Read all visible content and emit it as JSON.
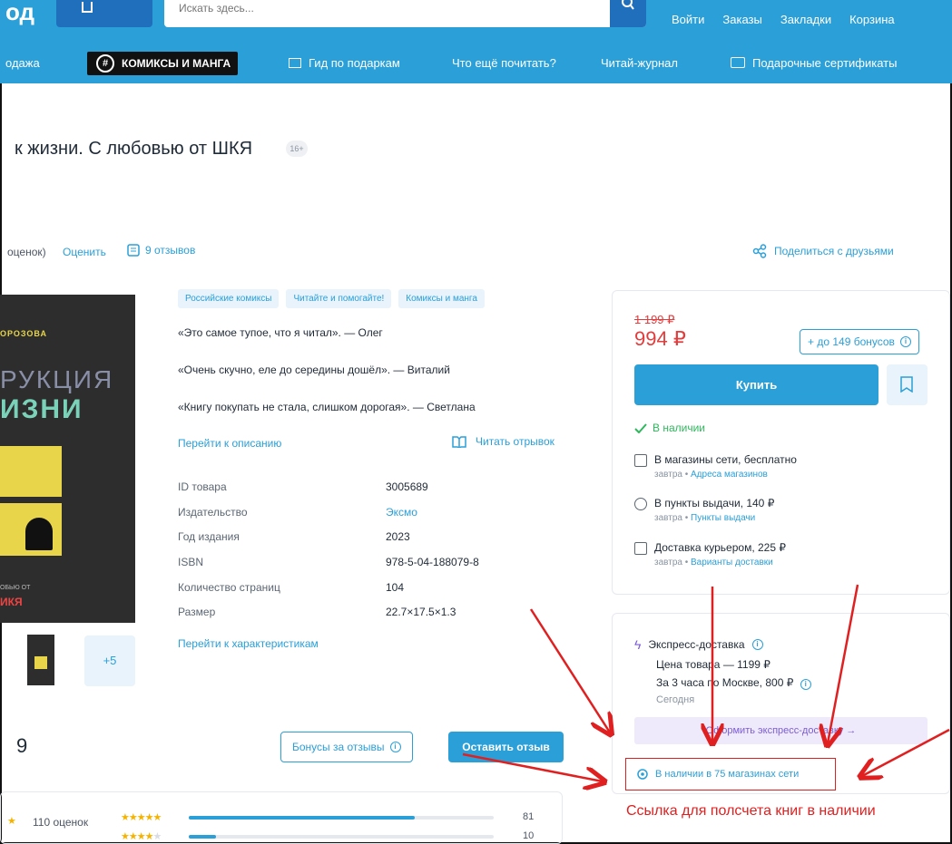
{
  "header": {
    "logo": "од",
    "search_placeholder": "Искать здесь...",
    "user_links": [
      "Войти",
      "Заказы",
      "Закладки",
      "Корзина"
    ]
  },
  "nav": {
    "items": [
      "одажа",
      "КОМИКСЫ И МАНГА",
      "Гид по подаркам",
      "Что ещё почитать?",
      "Читай-журнал",
      "Подарочные сертификаты"
    ]
  },
  "product": {
    "title": "к жизни. С любовью от ШКЯ",
    "age": "16+",
    "rating_text": "оценок)",
    "rate_link": "Оценить",
    "reviews_link": "9 отзывов",
    "share": "Поделиться с друзьями",
    "cover": {
      "line1": "ОРОЗОВА",
      "line2": "РУКЦИЯ",
      "line3": "ИЗНИ",
      "line4": "ОБЬЮ ОТ",
      "line5": "ИКЯ"
    },
    "more_images": "+5",
    "tags": [
      "Российские комиксы",
      "Читайте и помогайте!",
      "Комиксы и манга"
    ],
    "quotes": [
      "«Это самое тупое, что я читал». — Олег",
      "«Очень скучно, еле до середины дошёл». — Виталий",
      "«Книгу покупать не стала, слишком дорогая». — Светлана"
    ],
    "to_description": "Перейти к описанию",
    "read_excerpt": "Читать отрывок",
    "specs": [
      {
        "k": "ID товара",
        "v": "3005689"
      },
      {
        "k": "Издательство",
        "v": "Эксмо"
      },
      {
        "k": "Год издания",
        "v": "2023"
      },
      {
        "k": "ISBN",
        "v": "978-5-04-188079-8"
      },
      {
        "k": "Количество страниц",
        "v": "104"
      },
      {
        "k": "Размер",
        "v": "22.7×17.5×1.3"
      }
    ],
    "to_specs": "Перейти к характеристикам"
  },
  "buy": {
    "old_price": "1 199 ₽",
    "price": "994 ₽",
    "bonus": "+ до 149 бонусов",
    "buy_label": "Купить",
    "in_stock": "В наличии",
    "delivery": [
      {
        "title": "В магазины сети, бесплатно",
        "when": "завтра",
        "link": "Адреса магазинов"
      },
      {
        "title": "В пункты выдачи, 140 ₽",
        "when": "завтра",
        "link": "Пункты выдачи"
      },
      {
        "title": "Доставка курьером, 225 ₽",
        "when": "завтра",
        "link": "Варианты доставки"
      }
    ]
  },
  "express": {
    "title": "Экспресс-доставка",
    "price_line": "Цена товара — 1199 ₽",
    "time_line": "За 3 часа по Москве, 800 ₽",
    "today": "Сегодня",
    "button": "Оформить экспресс-доставку →",
    "stock_link": "В наличии в 75 магазинах сети"
  },
  "reviews": {
    "count": "9",
    "bonus_button": "Бонусы за отзывы",
    "leave_button": "Оставить отзыв",
    "total_ratings": "110 оценок",
    "distribution": [
      {
        "stars": 5,
        "count": "81",
        "fraction": 0.74
      },
      {
        "stars": 4,
        "count": "10",
        "fraction": 0.09
      }
    ]
  },
  "annotation": "Ссылка для полсчета книг в наличии",
  "colors": {
    "brand": "#2a9fd8",
    "price": "#e23c3c",
    "annotation": "#e02020",
    "express": "#7c5cd6"
  }
}
